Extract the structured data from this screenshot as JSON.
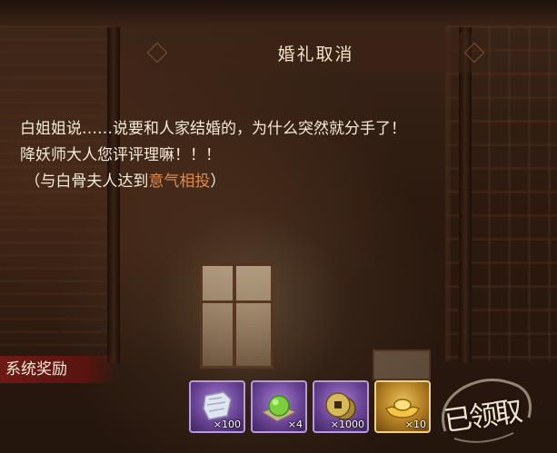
{
  "header": {
    "title": "婚礼取消"
  },
  "dialog": {
    "line1": "白姐姐说……说要和人家结婚的，为什么突然就分手了！",
    "line2": "降妖师大人您评评理嘛！！！",
    "condition_prefix": "（与白骨夫人达到",
    "condition_highlight": "意气相投",
    "condition_suffix": "）"
  },
  "rewards": {
    "label": "系统奖励",
    "items": [
      {
        "icon": "cloth-icon",
        "count": "×100",
        "rarity": "purple"
      },
      {
        "icon": "green-orb-icon",
        "count": "×4",
        "rarity": "purple"
      },
      {
        "icon": "copper-coin-icon",
        "count": "×1000",
        "rarity": "purple"
      },
      {
        "icon": "gold-ingot-icon",
        "count": "×10",
        "rarity": "gold"
      }
    ]
  },
  "stamp": {
    "text": "已领取"
  },
  "colors": {
    "highlight": "#e08a4e",
    "reward_band": "#6e1a14",
    "purple_frame": "#b99ad8",
    "gold_frame": "#f0d27a"
  }
}
